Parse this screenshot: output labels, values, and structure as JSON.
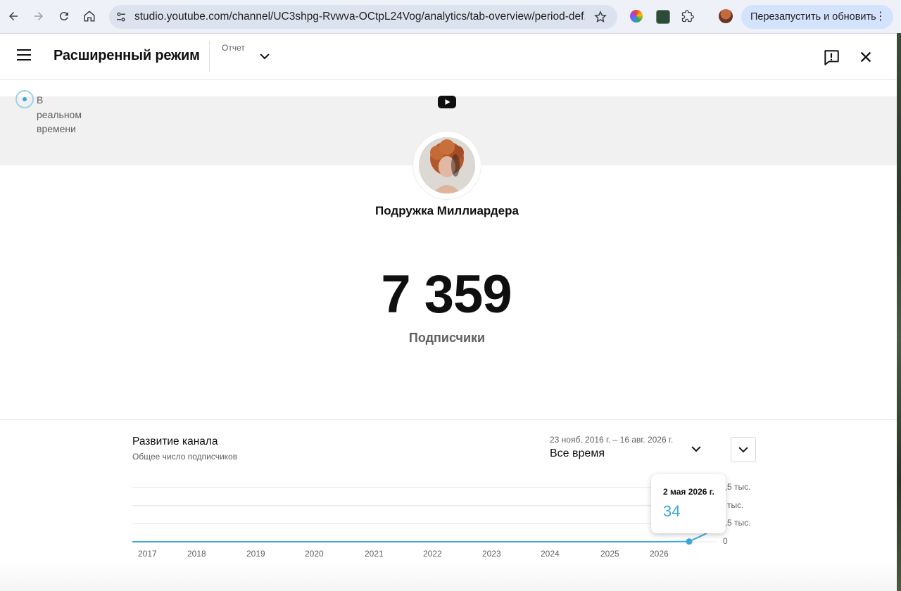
{
  "browser": {
    "url": "studio.youtube.com/channel/UC3shpg-Rvwva-OCtpL24Vog/analytics/tab-overview/period-def...",
    "relaunch_label": "Перезапустить и обновить"
  },
  "header": {
    "title": "Расширенный режим",
    "report_label": "Отчет"
  },
  "realtime": {
    "line1": "В",
    "line2": "реальном",
    "line3": "времени"
  },
  "channel": {
    "name": "Подружка Миллиардера",
    "subscribers": "7 359",
    "subscribers_label": "Подписчики"
  },
  "growth": {
    "title": "Развитие канала",
    "subtitle": "Общее число подписчиков",
    "range_dates": "23 нояб. 2016 г. – 16 авг. 2026 г.",
    "range_value": "Все время"
  },
  "tooltip": {
    "date": "2 мая 2026 г.",
    "value": "34"
  },
  "colors": {
    "accent": "#3ea6d9",
    "chrome_bg": "#eef1f8",
    "relaunch_bg": "#d3e3fd"
  },
  "chart_data": {
    "type": "line",
    "title": "Развитие канала",
    "x": [
      "2017",
      "2018",
      "2019",
      "2020",
      "2021",
      "2022",
      "2023",
      "2024",
      "2025",
      "2026",
      "2026-05-02",
      "2026-08"
    ],
    "series": [
      {
        "values": [
          0,
          0,
          0,
          0,
          0,
          0,
          0,
          0,
          0,
          0,
          34,
          7359
        ]
      }
    ],
    "x_ticks": [
      "2017",
      "2018",
      "2019",
      "2020",
      "2021",
      "2022",
      "2023",
      "2024",
      "2025",
      "2026"
    ],
    "y_ticks": [
      "0",
      "2,5 тыс.",
      "5 тыс.",
      "7,5 тыс."
    ],
    "ylim": [
      0,
      7500
    ],
    "grid": true
  }
}
